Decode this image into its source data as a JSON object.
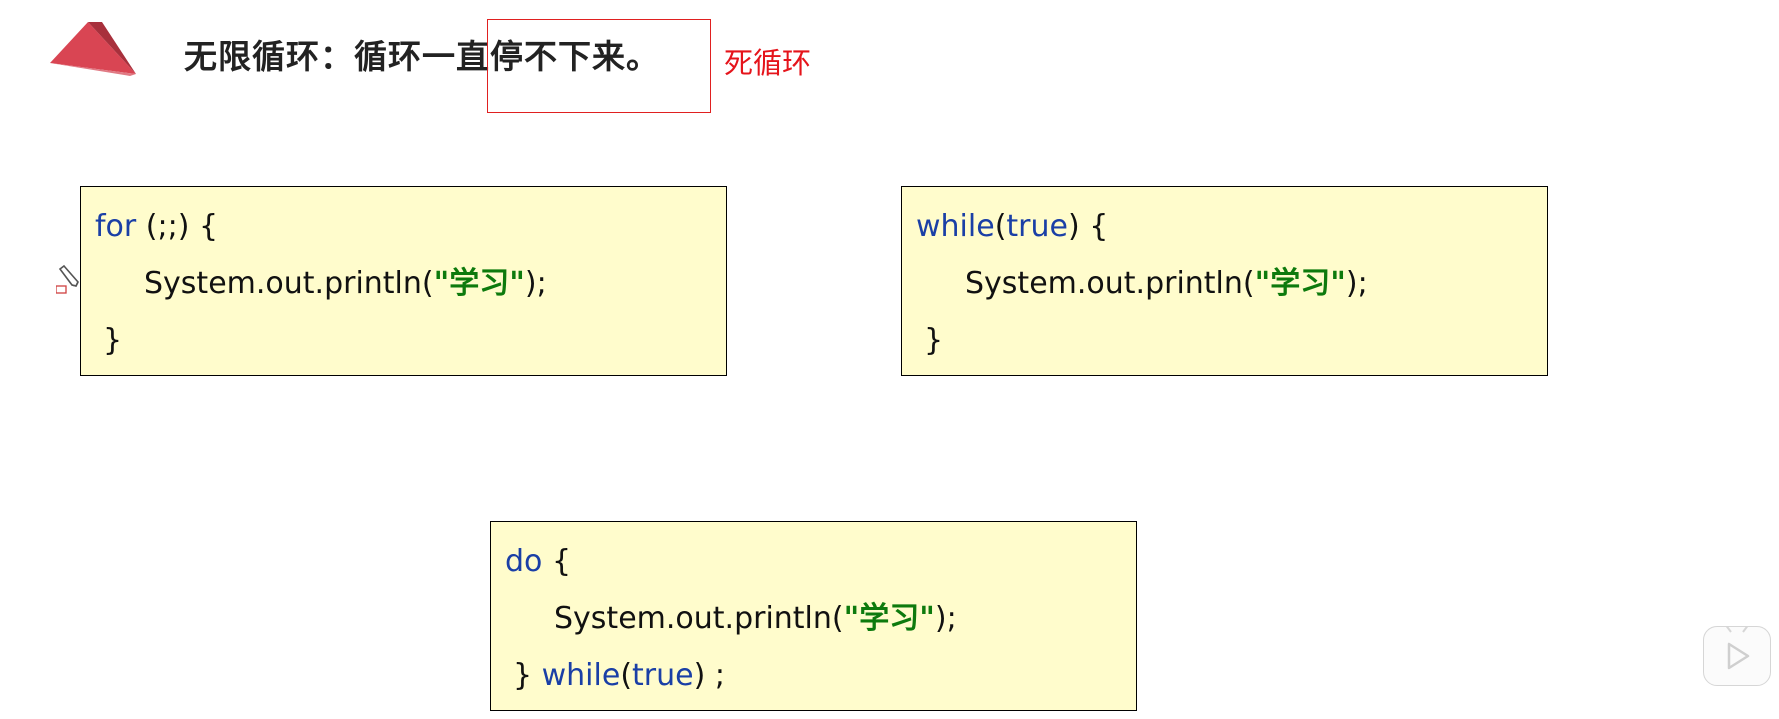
{
  "slide": {
    "title": "无限循环：循环一直停不下来。",
    "annotation": "死循环",
    "logo_icon": "red-triangle-logo-icon"
  },
  "code_blocks": [
    {
      "name": "for-loop",
      "line1": {
        "keyword": "for",
        "rest": " (;;) {"
      },
      "line2": {
        "pre": "System.out.println(",
        "string": "\"学习\"",
        "post": ");"
      },
      "line3": {
        "pre": "}"
      }
    },
    {
      "name": "while-loop",
      "line1": {
        "keyword": "while",
        "paren_open": "(",
        "keyword2": "true",
        "rest": ") {"
      },
      "line2": {
        "pre": "System.out.println(",
        "string": "\"学习\"",
        "post": ");"
      },
      "line3": {
        "pre": "}"
      }
    },
    {
      "name": "do-while-loop",
      "line1": {
        "keyword": "do",
        "rest": " {"
      },
      "line2": {
        "pre": "System.out.println(",
        "string": "\"学习\"",
        "post": ");"
      },
      "line3": {
        "pre": "} ",
        "keyword": "while",
        "paren_open": "(",
        "keyword2": "true",
        "rest": ") ;"
      }
    }
  ],
  "colors": {
    "keyword": "#1a3fa6",
    "string": "#0d7a0d",
    "code_bg": "#fffccc",
    "annotation": "#e5141b"
  },
  "overlay": {
    "play_icon": "play-icon",
    "pencil_icon": "pencil-cursor-icon"
  }
}
